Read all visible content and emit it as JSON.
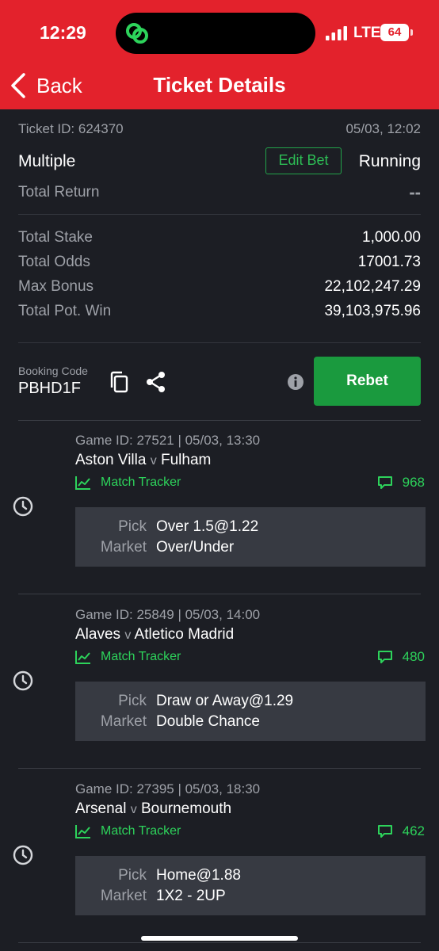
{
  "status_bar": {
    "time": "12:29",
    "network": "LTE",
    "battery": "64"
  },
  "nav": {
    "back_label": "Back",
    "title": "Ticket Details"
  },
  "ticket": {
    "id_label": "Ticket ID: 624370",
    "datetime": "05/03, 12:02",
    "type": "Multiple",
    "edit_bet_label": "Edit Bet",
    "status": "Running",
    "total_return_label": "Total Return",
    "total_return_value": "--",
    "summary": [
      {
        "label": "Total Stake",
        "value": "1,000.00"
      },
      {
        "label": "Total Odds",
        "value": "17001.73"
      },
      {
        "label": "Max Bonus",
        "value": "22,102,247.29"
      },
      {
        "label": "Total Pot. Win",
        "value": "39,103,975.96"
      }
    ],
    "booking_code_label": "Booking Code",
    "booking_code": "PBHD1F",
    "rebet_label": "Rebet"
  },
  "games": [
    {
      "game_id": "Game ID: 27521 | 05/03, 13:30",
      "home": "Aston Villa",
      "sep": "v",
      "away": "Fulham",
      "tracker_label": "Match Tracker",
      "comments": "968",
      "pick_label": "Pick",
      "pick": "Over 1.5@1.22",
      "market_label": "Market",
      "market": "Over/Under"
    },
    {
      "game_id": "Game ID: 25849 | 05/03, 14:00",
      "home": "Alaves",
      "sep": "v",
      "away": "Atletico Madrid",
      "tracker_label": "Match Tracker",
      "comments": "480",
      "pick_label": "Pick",
      "pick": "Draw or Away@1.29",
      "market_label": "Market",
      "market": "Double Chance"
    },
    {
      "game_id": "Game ID: 27395 | 05/03, 18:30",
      "home": "Arsenal",
      "sep": "v",
      "away": "Bournemouth",
      "tracker_label": "Match Tracker",
      "comments": "462",
      "pick_label": "Pick",
      "pick": "Home@1.88",
      "market_label": "Market",
      "market": "1X2 - 2UP"
    }
  ],
  "colors": {
    "header_red": "#e3222c",
    "background": "#1c1e24",
    "accent_green": "#2dd35b",
    "rebet_green": "#1a9a3e"
  },
  "icons": [
    "app-logo-icon",
    "signal-icon",
    "battery-icon",
    "back-chevron-icon",
    "copy-icon",
    "share-icon",
    "info-icon",
    "clock-icon",
    "chart-icon",
    "comment-icon"
  ]
}
